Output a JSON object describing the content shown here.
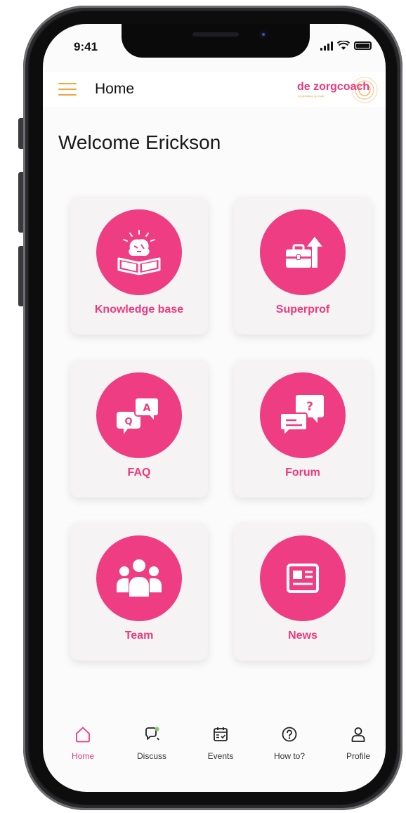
{
  "status_bar": {
    "time": "9:41"
  },
  "header": {
    "title": "Home",
    "logo_text": "de zorgcoach",
    "logo_tagline": "begeleiding op maat"
  },
  "welcome": "Welcome Erickson",
  "tiles": [
    {
      "label": "Knowledge base",
      "icon": "knowledge-book-icon"
    },
    {
      "label": "Superprof",
      "icon": "briefcase-arrow-icon"
    },
    {
      "label": "FAQ",
      "icon": "qa-bubbles-icon"
    },
    {
      "label": "Forum",
      "icon": "forum-chat-icon"
    },
    {
      "label": "Team",
      "icon": "team-icon"
    },
    {
      "label": "News",
      "icon": "newspaper-icon"
    }
  ],
  "nav": [
    {
      "label": "Home",
      "icon": "home-icon",
      "active": true
    },
    {
      "label": "Discuss",
      "icon": "discuss-icon"
    },
    {
      "label": "Events",
      "icon": "calendar-icon"
    },
    {
      "label": "How to?",
      "icon": "help-icon"
    },
    {
      "label": "Profile",
      "icon": "profile-icon"
    }
  ],
  "colors": {
    "accent": "#ee3d82",
    "menu": "#f0a63a",
    "logo_orange": "#f29b3a"
  }
}
